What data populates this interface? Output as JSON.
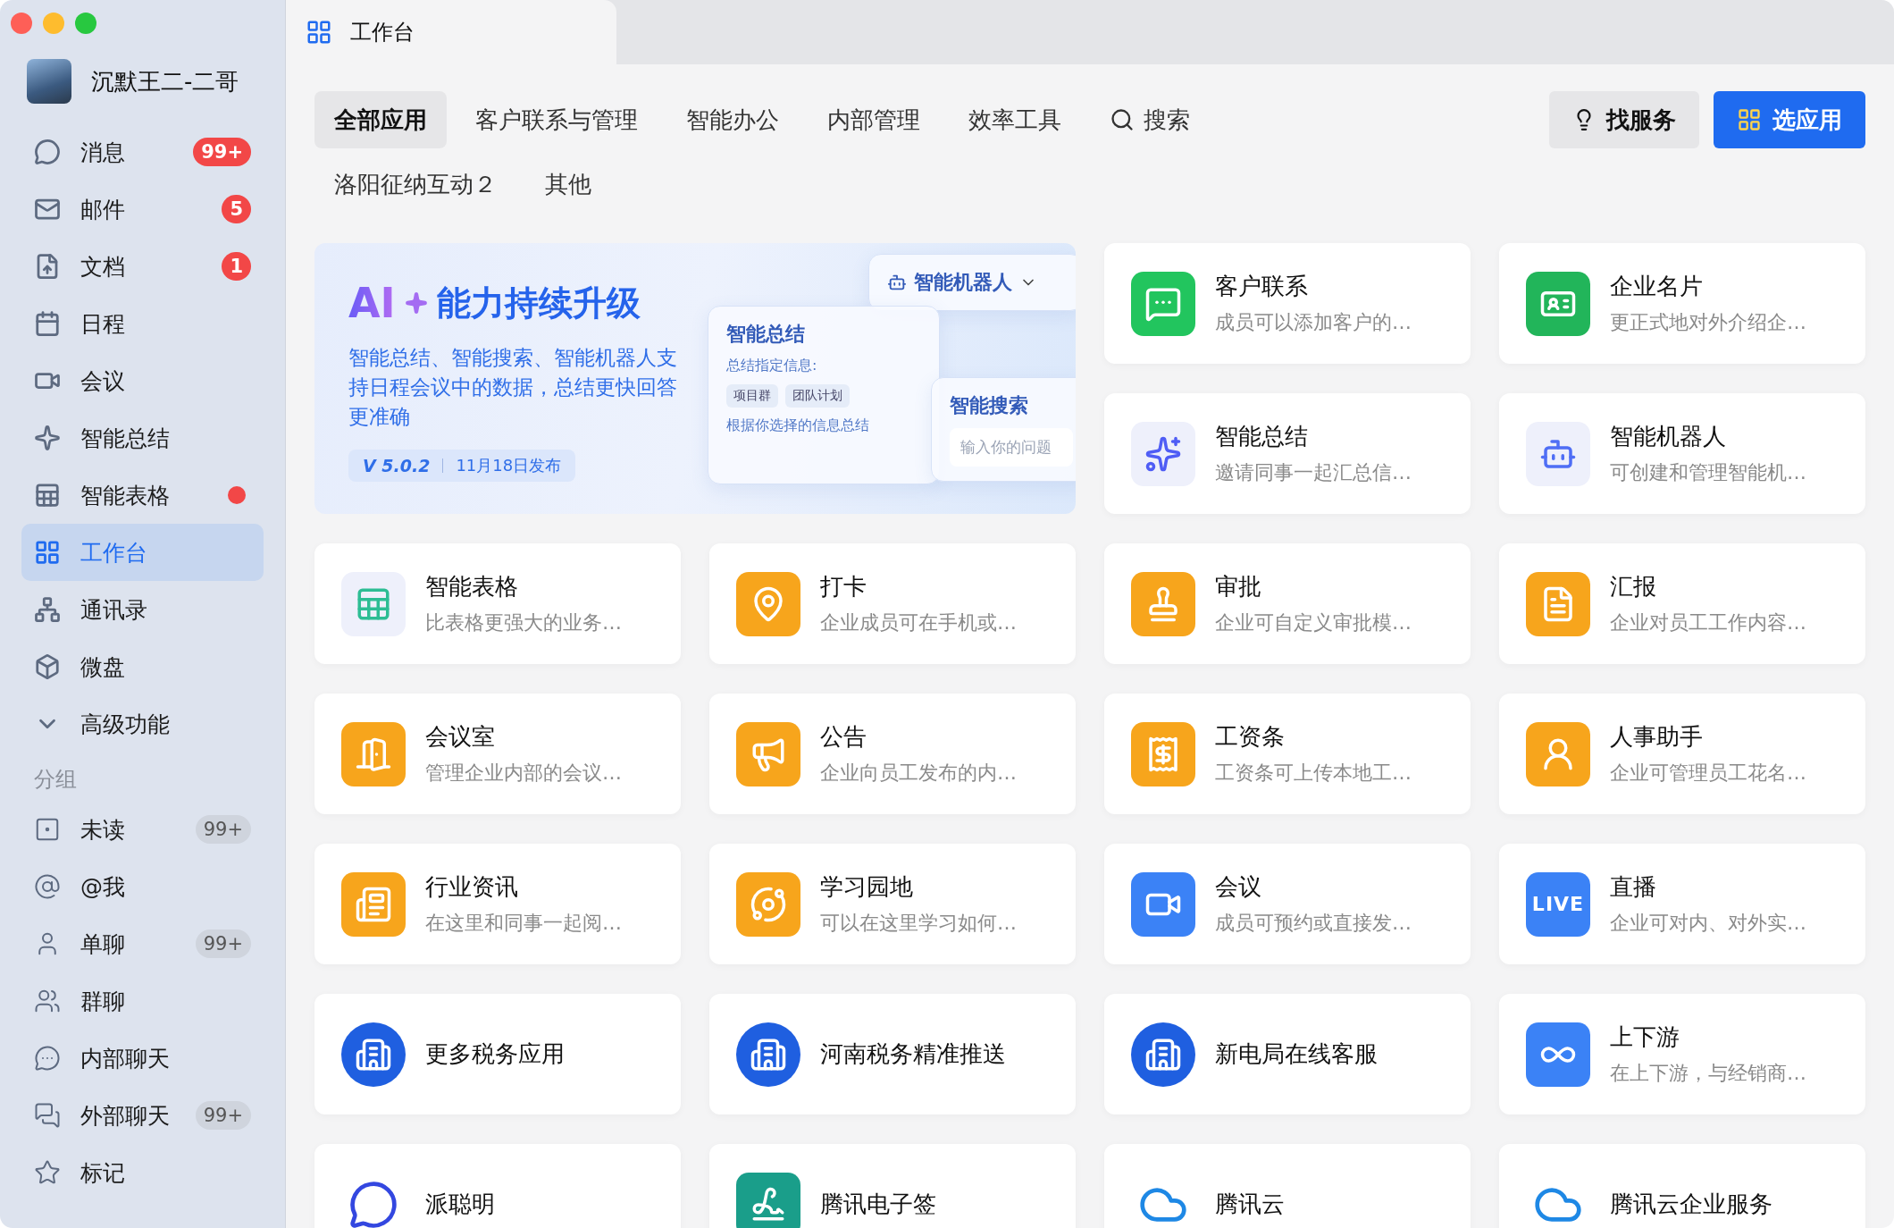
{
  "window": {
    "title": "工作台"
  },
  "sidebar": {
    "user": {
      "name": "沉默王二-二哥"
    },
    "items": [
      {
        "label": "消息",
        "selected": false,
        "badge": {
          "text": "99+",
          "kind": "alert"
        }
      },
      {
        "label": "邮件",
        "selected": false,
        "badge": {
          "text": "5",
          "kind": "alert"
        }
      },
      {
        "label": "文档",
        "selected": false,
        "badge": {
          "text": "1",
          "kind": "alert"
        }
      },
      {
        "label": "日程",
        "selected": false
      },
      {
        "label": "会议",
        "selected": false
      },
      {
        "label": "智能总结",
        "selected": false
      },
      {
        "label": "智能表格",
        "selected": false,
        "dot": true
      },
      {
        "label": "工作台",
        "selected": true
      },
      {
        "label": "通讯录",
        "selected": false
      },
      {
        "label": "微盘",
        "selected": false
      },
      {
        "label": "高级功能",
        "selected": false
      }
    ],
    "group_heading": "分组",
    "groups": [
      {
        "label": "未读",
        "selected": false,
        "badge": {
          "text": "99+",
          "kind": "muted"
        }
      },
      {
        "label": "@我",
        "selected": false
      },
      {
        "label": "单聊",
        "selected": false,
        "badge": {
          "text": "99+",
          "kind": "muted"
        }
      },
      {
        "label": "群聊",
        "selected": false
      },
      {
        "label": "内部聊天",
        "selected": false
      },
      {
        "label": "外部聊天",
        "selected": false,
        "badge": {
          "text": "99+",
          "kind": "muted"
        }
      },
      {
        "label": "标记",
        "selected": false
      }
    ]
  },
  "categories": [
    {
      "label": "全部应用",
      "selected": true
    },
    {
      "label": "客户联系与管理",
      "selected": false
    },
    {
      "label": "智能办公",
      "selected": false
    },
    {
      "label": "内部管理",
      "selected": false
    },
    {
      "label": "效率工具",
      "selected": false
    },
    {
      "label": "洛阳征纳互动２",
      "selected": false
    },
    {
      "label": "其他",
      "selected": false
    }
  ],
  "search": {
    "label": "搜索"
  },
  "buttons": [
    {
      "label": "找服务",
      "kind": "secondary"
    },
    {
      "label": "选应用",
      "kind": "primary"
    }
  ],
  "banner": {
    "title_ai": "AI",
    "title": "能力持续升级",
    "description": "智能总结、智能搜索、智能机器人支持日程会议中的数据，总结更快回答更准确",
    "version": "V 5.0.2",
    "date": "11月18日发布",
    "mock": {
      "robot": "智能机器人",
      "summary": "智能总结",
      "summary_hint": "总结指定信息:",
      "chips": [
        "项目群",
        "团队计划"
      ],
      "summary_note": "根据你选择的信息总结",
      "search": "智能搜索",
      "search_placeholder": "输入你的问题"
    }
  },
  "apps": [
    {
      "name": "客户联系",
      "description": "成员可以添加客户的…",
      "color": "#22c55e",
      "kind": "square"
    },
    {
      "name": "企业名片",
      "description": "更正式地对外介绍企…",
      "color": "#22b55a",
      "kind": "square"
    },
    {
      "name": "智能总结",
      "description": "邀请同事一起汇总信…",
      "color": "#4f5df5",
      "kind": "soft"
    },
    {
      "name": "智能机器人",
      "description": "可创建和管理智能机…",
      "color": "#4f6ef5",
      "kind": "soft"
    },
    {
      "name": "智能表格",
      "description": "比表格更强大的业务…",
      "color": "#2dbd94",
      "kind": "soft"
    },
    {
      "name": "打卡",
      "description": "企业成员可在手机或…",
      "color": "#f7a51c",
      "kind": "square"
    },
    {
      "name": "审批",
      "description": "企业可自定义审批模…",
      "color": "#f7a51c",
      "kind": "square"
    },
    {
      "name": "汇报",
      "description": "企业对员工工作内容…",
      "color": "#f7a51c",
      "kind": "square"
    },
    {
      "name": "会议室",
      "description": "管理企业内部的会议…",
      "color": "#f7a51c",
      "kind": "square"
    },
    {
      "name": "公告",
      "description": "企业向员工发布的内…",
      "color": "#f7a51c",
      "kind": "square"
    },
    {
      "name": "工资条",
      "description": "工资条可上传本地工…",
      "color": "#f7a51c",
      "kind": "square"
    },
    {
      "name": "人事助手",
      "description": "企业可管理员工花名…",
      "color": "#f7a51c",
      "kind": "square"
    },
    {
      "name": "行业资讯",
      "description": "在这里和同事一起阅…",
      "color": "#f7a51c",
      "kind": "square"
    },
    {
      "name": "学习园地",
      "description": "可以在这里学习如何…",
      "color": "#f7a51c",
      "kind": "square"
    },
    {
      "name": "会议",
      "description": "成员可预约或直接发…",
      "color": "#3b82f6",
      "kind": "square"
    },
    {
      "name": "直播",
      "description": "企业可对内、对外实…",
      "color": "#3b82f6",
      "kind": "square",
      "icon_text": "LIVE"
    },
    {
      "name": "更多税务应用",
      "color": "#1f5fe0",
      "kind": "circle"
    },
    {
      "name": "河南税务精准推送",
      "color": "#1f5fe0",
      "kind": "circle"
    },
    {
      "name": "新电局在线客服",
      "color": "#1f5fe0",
      "kind": "circle"
    },
    {
      "name": "上下游",
      "description": "在上下游，与经销商…",
      "color": "#3b82f6",
      "kind": "square"
    },
    {
      "name": "派聪明",
      "color": "#3347e0",
      "kind": "plain"
    },
    {
      "name": "腾讯电子签",
      "color": "#1a9e8a",
      "kind": "square"
    },
    {
      "name": "腾讯云",
      "color": "#1e88e5",
      "kind": "plain"
    },
    {
      "name": "腾讯云企业服务",
      "color": "#1e88e5",
      "kind": "plain"
    }
  ]
}
